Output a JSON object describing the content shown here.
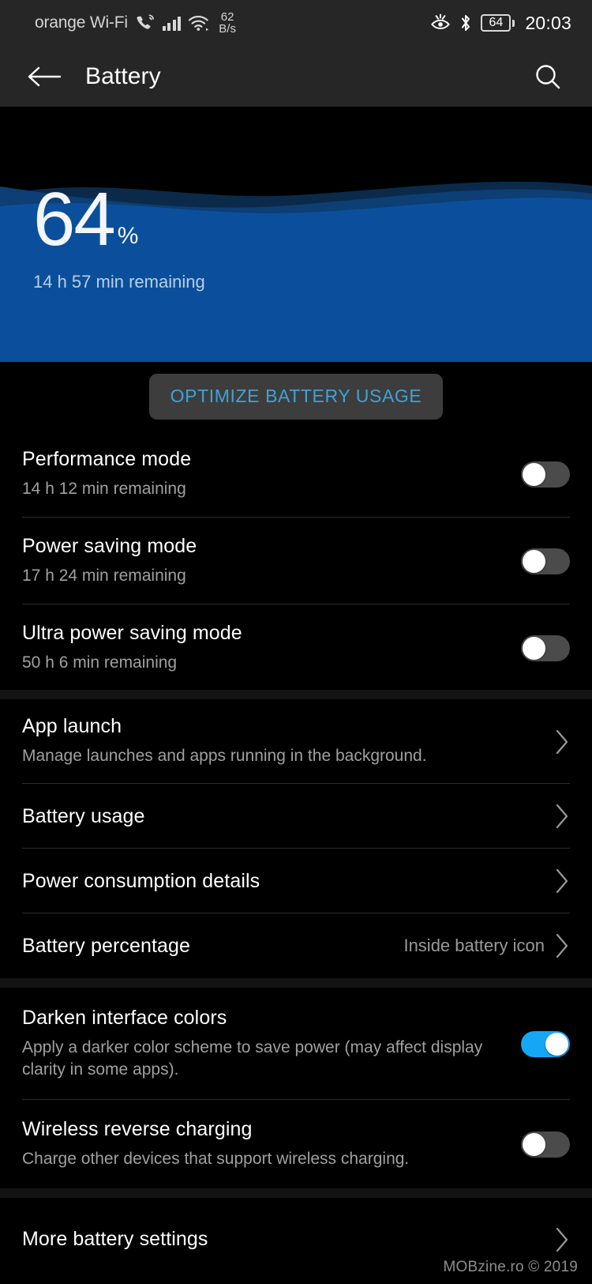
{
  "statusbar": {
    "carrier": "orange Wi-Fi",
    "call_wifi_icon": "call-over-wifi-icon",
    "signal_icon": "cellular-signal-icon",
    "wifi_icon": "wifi-icon",
    "data_rate_value": "62",
    "data_rate_unit": "B/s",
    "eye_comfort_icon": "eye-comfort-icon",
    "bluetooth_icon": "bluetooth-icon",
    "battery_level": "64",
    "time": "20:03"
  },
  "appbar": {
    "back_icon": "back-arrow-icon",
    "title": "Battery",
    "search_icon": "search-icon"
  },
  "hero": {
    "percent": "64",
    "percent_symbol": "%",
    "remaining": "14 h 57 min remaining",
    "wave_back_color": "#0b2a4a",
    "wave_mid_color": "#134a8a",
    "wave_front_color": "#0b4f9c"
  },
  "optimize": {
    "label": "OPTIMIZE BATTERY USAGE",
    "text_color": "#3ea2d8",
    "bg_color": "#3d3d3d"
  },
  "modes": [
    {
      "title": "Performance mode",
      "subtitle": "14 h 12 min remaining",
      "toggle": "off"
    },
    {
      "title": "Power saving mode",
      "subtitle": "17 h 24 min remaining",
      "toggle": "off"
    },
    {
      "title": "Ultra power saving mode",
      "subtitle": "50 h 6 min remaining",
      "toggle": "off"
    }
  ],
  "links": [
    {
      "title": "App launch",
      "subtitle": "Manage launches and apps running in the background.",
      "value": "",
      "chevron": "chevron-right-icon"
    },
    {
      "title": "Battery usage",
      "subtitle": "",
      "value": "",
      "chevron": "chevron-right-icon"
    },
    {
      "title": "Power consumption details",
      "subtitle": "",
      "value": "",
      "chevron": "chevron-right-icon"
    },
    {
      "title": "Battery percentage",
      "subtitle": "",
      "value": "Inside battery icon",
      "chevron": "chevron-right-icon"
    }
  ],
  "switches": [
    {
      "title": "Darken interface colors",
      "subtitle": "Apply a darker color scheme to save power (may affect display clarity in some apps).",
      "toggle": "on"
    },
    {
      "title": "Wireless reverse charging",
      "subtitle": "Charge other devices that support wireless charging.",
      "toggle": "off"
    }
  ],
  "footer": {
    "title": "More battery settings",
    "chevron": "chevron-right-icon"
  },
  "watermark": "MOBzine.ro © 2019",
  "colors": {
    "accent_blue": "#15a7f5",
    "link_blue": "#3ea2d8",
    "hero_blue": "#0b4f9c",
    "bar_bg": "#262626",
    "page_bg": "#000000"
  }
}
